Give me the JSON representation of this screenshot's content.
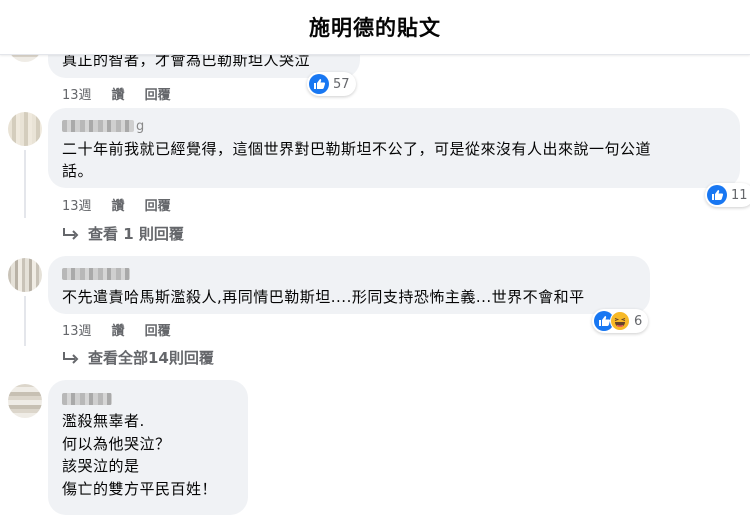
{
  "header": {
    "title": "施明德的貼文"
  },
  "comments": [
    {
      "text": "真正的智者，才會為巴勒斯坦人哭泣",
      "time": "13週",
      "like": "讚",
      "reply": "回覆",
      "reaction_count": "57",
      "reactions": [
        "like-icon"
      ]
    },
    {
      "name_partial": "g",
      "text": "二十年前我就已經覺得，這個世界對巴勒斯坦不公了，可是從來沒有人出來說一句公道\n話。",
      "time": "13週",
      "like": "讚",
      "reply": "回覆",
      "reaction_count": "11",
      "reactions": [
        "like-icon"
      ],
      "view_replies": "查看 1 則回覆"
    },
    {
      "text": "不先遣責哈馬斯濫殺人,再同情巴勒斯坦....形同支持恐怖主義...世界不會和平",
      "time": "13週",
      "like": "讚",
      "reply": "回覆",
      "reaction_count": "6",
      "reactions": [
        "like-icon",
        "haha-icon"
      ],
      "view_replies": "查看全部14則回覆"
    },
    {
      "text": "濫殺無辜者.\n何以為他哭泣？\n該哭泣的是\n傷亡的雙方平民百姓！"
    }
  ],
  "colors": {
    "like_blue": "#1877f2",
    "haha_yellow": "#f7b928",
    "bubble": "#f0f2f5",
    "meta": "#65676b"
  }
}
